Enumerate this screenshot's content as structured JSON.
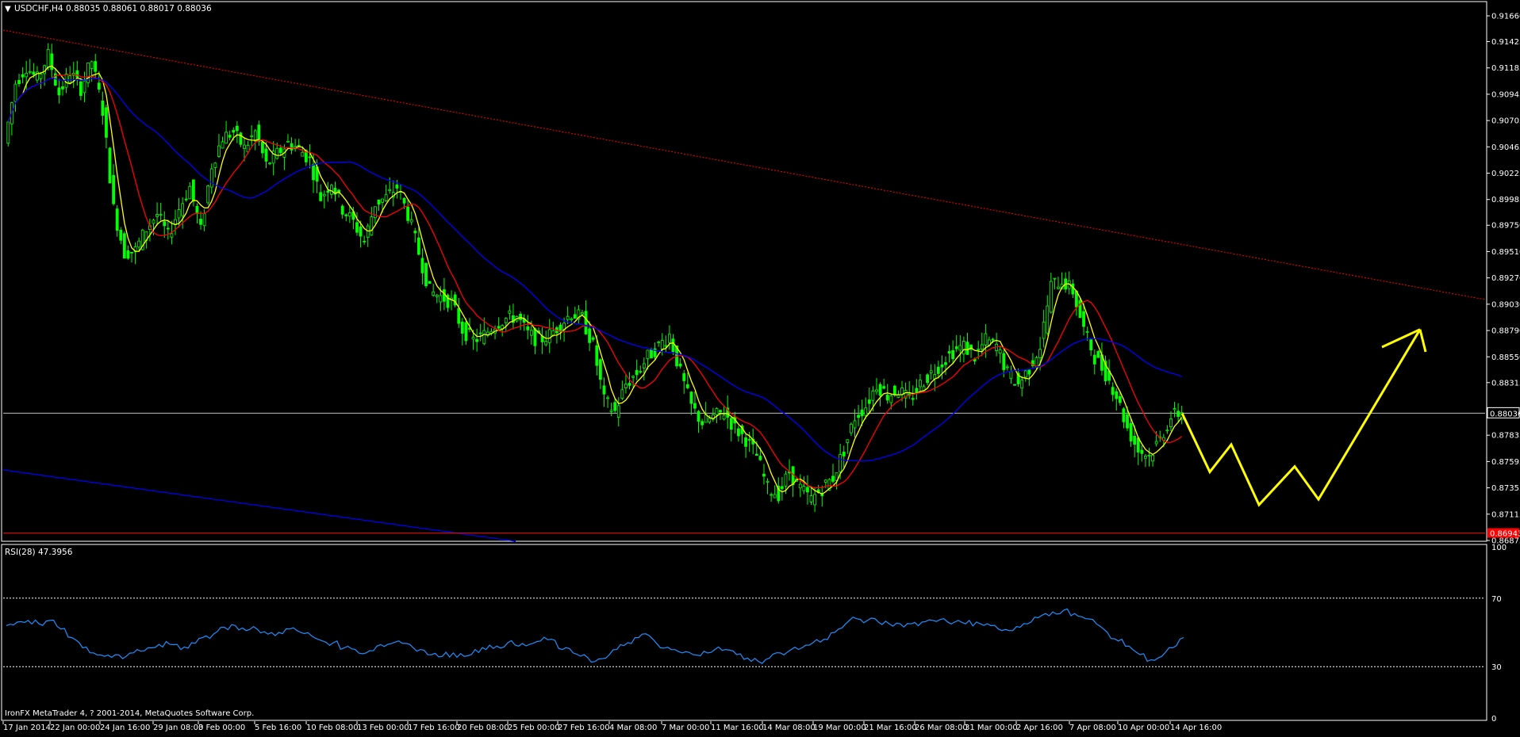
{
  "window": {
    "symbol_line": "USDCHF,H4  0.88035 0.88061 0.88017 0.88036",
    "copyright": "IronFX MetaTrader 4, ? 2001-2014, MetaQuotes Software Corp."
  },
  "colors": {
    "background": "#000000",
    "axis": "#ffffff",
    "candle": "#00ff00",
    "ma_fast": "#ffff00",
    "ma_mid": "#ff0000",
    "ma_slow": "#0000ff",
    "rsi": "#1e90ff",
    "projection": "#ffff00",
    "resistance": "#ff0000",
    "support_line": "#ff0000",
    "price_label_bg": "#ff0000"
  },
  "chart_data": [
    {
      "type": "candlestick",
      "symbol": "USDCHF",
      "timeframe": "H4",
      "ohlc_last": {
        "open": 0.88035,
        "high": 0.88061,
        "low": 0.88017,
        "close": 0.88036
      },
      "ylim": [
        0.86875,
        0.9166
      ],
      "y_ticks": [
        0.9166,
        0.91425,
        0.91185,
        0.90945,
        0.90705,
        0.90465,
        0.90225,
        0.89985,
        0.8975,
        0.8951,
        0.8927,
        0.8903,
        0.8879,
        0.8855,
        0.88315,
        0.88036,
        0.87835,
        0.87595,
        0.87355,
        0.87115,
        0.86875
      ],
      "y_tick_labels": [
        "0.91660",
        "0.91425",
        "0.91185",
        "0.90945",
        "0.90705",
        "0.90465",
        "0.90225",
        "0.89985",
        "0.89750",
        "0.89510",
        "0.89270",
        "0.89030",
        "0.88790",
        "0.88550",
        "0.88315",
        "0.88036",
        "0.87835",
        "0.87595",
        "0.87355",
        "0.87115",
        "0.86875"
      ],
      "current_price": 0.88036,
      "current_price_label": "0.88036",
      "support_label": "0.86943",
      "support_price": 0.86943,
      "x_tick_labels": [
        "17 Jan 2014",
        "22 Jan 00:00",
        "24 Jan 16:00",
        "29 Jan 08:00",
        "3 Feb 00:00",
        "5 Feb 16:00",
        "10 Feb 08:00",
        "13 Feb 00:00",
        "17 Feb 16:00",
        "20 Feb 08:00",
        "25 Feb 00:00",
        "27 Feb 16:00",
        "4 Mar 08:00",
        "7 Mar 00:00",
        "11 Mar 16:00",
        "14 Mar 08:00",
        "19 Mar 00:00",
        "21 Mar 16:00",
        "26 Mar 08:00",
        "31 Mar 00:00",
        "2 Apr 16:00",
        "7 Apr 08:00",
        "10 Apr 00:00",
        "14 Apr 16:00"
      ],
      "close_series": [
        0.905,
        0.9105,
        0.912,
        0.9108,
        0.913,
        0.9095,
        0.9115,
        0.91,
        0.9125,
        0.908,
        0.899,
        0.895,
        0.8952,
        0.8972,
        0.8985,
        0.8965,
        0.899,
        0.901,
        0.897,
        0.903,
        0.9055,
        0.906,
        0.9045,
        0.906,
        0.903,
        0.904,
        0.905,
        0.9045,
        0.9035,
        0.9,
        0.9015,
        0.899,
        0.8978,
        0.896,
        0.8995,
        0.9,
        0.901,
        0.8985,
        0.895,
        0.8915,
        0.891,
        0.8905,
        0.888,
        0.887,
        0.8875,
        0.8885,
        0.889,
        0.8892,
        0.8876,
        0.887,
        0.8875,
        0.8885,
        0.8895,
        0.889,
        0.8865,
        0.8815,
        0.8805,
        0.883,
        0.884,
        0.8855,
        0.8865,
        0.8875,
        0.884,
        0.881,
        0.8795,
        0.88,
        0.8805,
        0.879,
        0.878,
        0.8765,
        0.8735,
        0.873,
        0.875,
        0.8735,
        0.8725,
        0.8735,
        0.8745,
        0.877,
        0.88,
        0.881,
        0.883,
        0.882,
        0.8825,
        0.8815,
        0.883,
        0.884,
        0.885,
        0.886,
        0.8865,
        0.8855,
        0.887,
        0.8865,
        0.884,
        0.883,
        0.8845,
        0.8865,
        0.892,
        0.8925,
        0.8915,
        0.888,
        0.8855,
        0.884,
        0.882,
        0.879,
        0.877,
        0.8765,
        0.878,
        0.88,
        0.8805
      ],
      "series": [
        {
          "name": "RSI(28)",
          "value": 47.3956,
          "ylim": [
            0,
            100
          ],
          "levels": [
            70,
            30
          ],
          "y_tick_labels": [
            "100",
            "70",
            "30",
            "0"
          ],
          "values": [
            54,
            56,
            57,
            55,
            57,
            52,
            47,
            41,
            38,
            36,
            37,
            36,
            40,
            41,
            43,
            43,
            40,
            44,
            47,
            49,
            53,
            54,
            51,
            52,
            49,
            50,
            52,
            50,
            48,
            45,
            44,
            41,
            40,
            38,
            42,
            43,
            45,
            43,
            40,
            37,
            36,
            38,
            36,
            40,
            40,
            42,
            44,
            42,
            43,
            45,
            46,
            40,
            38,
            37,
            33,
            35,
            40,
            44,
            47,
            48,
            41,
            40,
            38,
            37,
            39,
            40,
            40,
            37,
            35,
            33,
            35,
            38,
            40,
            41,
            44,
            46,
            50,
            55,
            58,
            57,
            56,
            55,
            55,
            55,
            56,
            57,
            58,
            56,
            55,
            56,
            55,
            52,
            51,
            53,
            56,
            60,
            62,
            63,
            61,
            58,
            55,
            50,
            45,
            42,
            37,
            34,
            36,
            41,
            47
          ]
        }
      ],
      "projection": [
        0.88036,
        0.875,
        0.8775,
        0.872,
        0.8755,
        0.8725,
        0.888
      ],
      "title": "USDCHF,H4  0.88035 0.88061 0.88017 0.88036",
      "legend": "none",
      "grid": false
    }
  ]
}
